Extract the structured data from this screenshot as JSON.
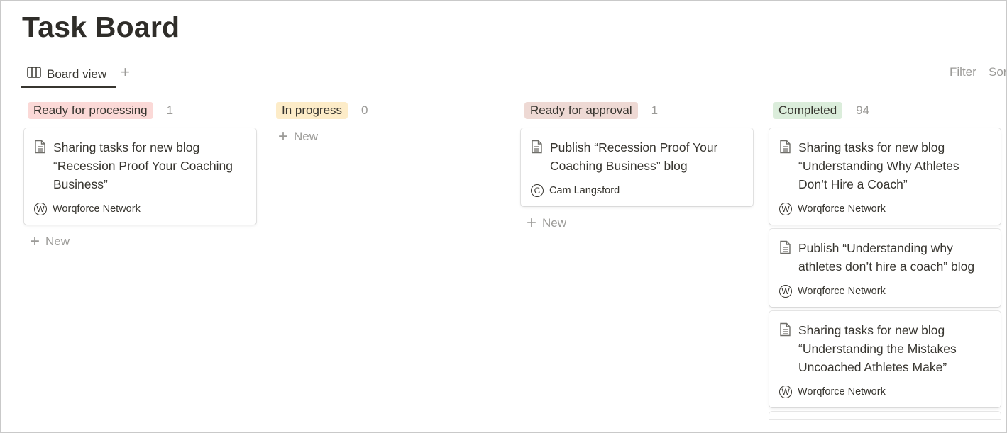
{
  "page": {
    "title": "Task Board"
  },
  "tabs": {
    "active_label": "Board view",
    "add_symbol": "+"
  },
  "toolbar": {
    "filter_label": "Filter",
    "sort_label": "Sor"
  },
  "new_label": "New",
  "new_symbol": "+",
  "columns": [
    {
      "label": "Ready for processing",
      "count": "1",
      "color": "#fbd9d7",
      "cards": [
        {
          "title": "Sharing tasks for new blog “Recession Proof Your Coaching Business”",
          "initial": "W",
          "prop": "Worqforce Network"
        }
      ]
    },
    {
      "label": "In progress",
      "count": "0",
      "color": "#fdecc8",
      "cards": []
    },
    {
      "label": "Ready for approval",
      "count": "1",
      "color": "#eed9d4",
      "cards": [
        {
          "title": "Publish “Recession Proof Your Coaching Business” blog",
          "initial": "C",
          "prop": "Cam Langsford"
        }
      ]
    },
    {
      "label": "Completed",
      "count": "94",
      "color": "#dbeddb",
      "cards": [
        {
          "title": "Sharing tasks for new blog “Understanding Why Athletes Don’t Hire a Coach”",
          "initial": "W",
          "prop": "Worqforce Network"
        },
        {
          "title": "Publish “Understanding why athletes don’t hire a coach” blog",
          "initial": "W",
          "prop": "Worqforce Network"
        },
        {
          "title": "Sharing tasks for new blog “Understanding the Mistakes Uncoached Athletes Make”",
          "initial": "W",
          "prop": "Worqforce Network"
        }
      ]
    }
  ]
}
